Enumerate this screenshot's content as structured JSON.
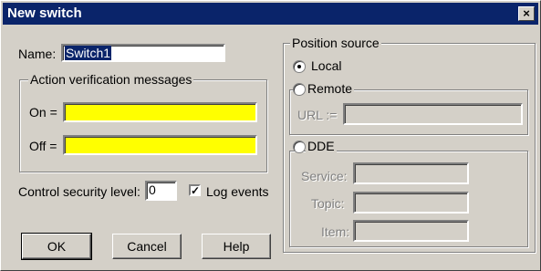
{
  "window": {
    "title": "New switch",
    "close_glyph": "×"
  },
  "name": {
    "label": "Name:",
    "value": "Switch1"
  },
  "action_group": {
    "legend": "Action verification messages",
    "on_label": "On =",
    "off_label": "Off =",
    "on_value": "",
    "off_value": ""
  },
  "security": {
    "label": "Control security level:",
    "value": "0"
  },
  "log_events": {
    "label": "Log events",
    "checked": true
  },
  "buttons": {
    "ok": "OK",
    "cancel": "Cancel",
    "help": "Help"
  },
  "position": {
    "legend": "Position source",
    "local_label": "Local",
    "remote_label": "Remote",
    "url_label": "URL :=",
    "dde_label": "DDE",
    "service_label": "Service:",
    "topic_label": "Topic:",
    "item_label": "Item:"
  },
  "colors": {
    "titlebar": "#0a246a",
    "field_highlight": "#ffff00",
    "dialog": "#d4d0c8"
  }
}
